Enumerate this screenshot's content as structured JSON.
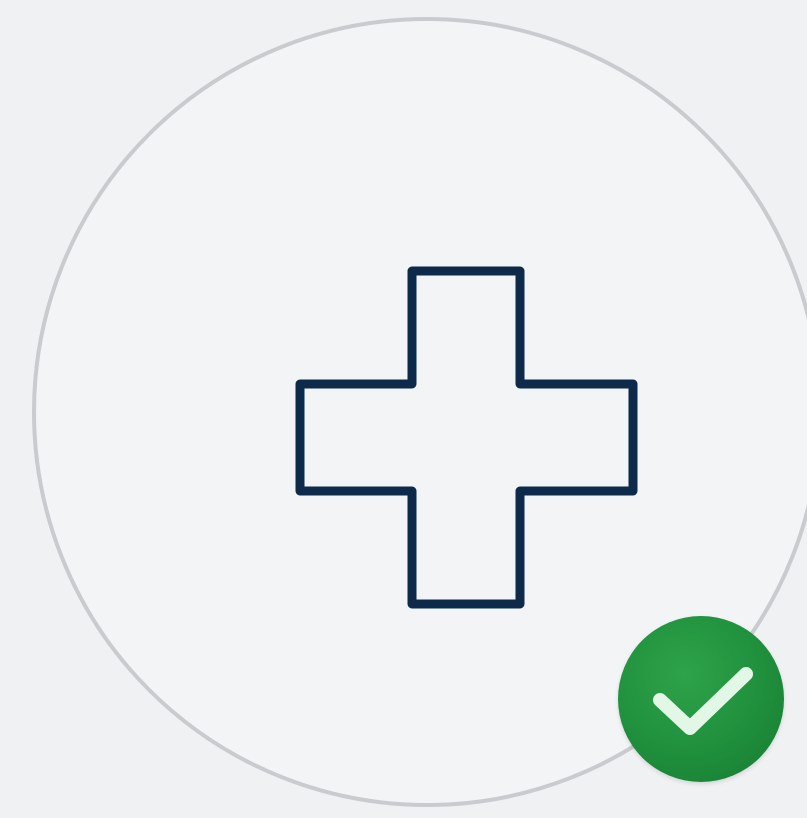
{
  "add_button": {
    "icon": "plus-icon",
    "state": "selected"
  },
  "status_badge": {
    "icon": "checkmark-icon",
    "status": "confirmed"
  },
  "colors": {
    "background": "#eff1f3",
    "circle_border": "#c9cbcf",
    "plus_stroke": "#0d2a4a",
    "badge_fill": "#1f8f3c",
    "check_stroke": "#e3f7e6"
  }
}
